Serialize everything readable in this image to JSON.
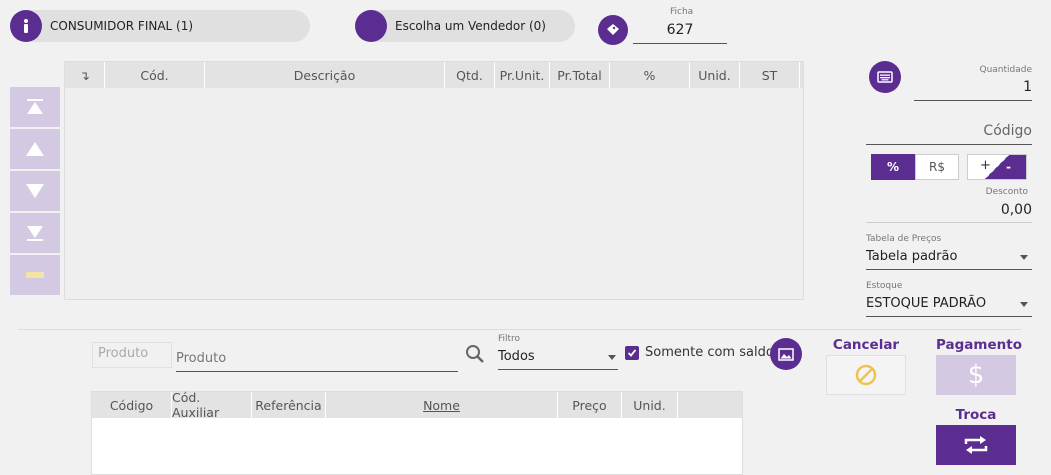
{
  "header": {
    "customer_label": "CONSUMIDOR FINAL (1)",
    "seller_label": "Escolha um Vendedor (0)",
    "ficha_label": "Ficha",
    "ficha_value": "627"
  },
  "items_table": {
    "columns": [
      "↴",
      "Cód.",
      "Descrição",
      "Qtd.",
      "Pr.Unit.",
      "Pr.Total",
      "%",
      "Unid.",
      "ST"
    ],
    "rows": []
  },
  "right_panel": {
    "quantidade_label": "Quantidade",
    "quantidade_value": "1",
    "codigo_placeholder": "Código",
    "percent_label": "%",
    "currency_label": "R$",
    "plus_label": "+",
    "minus_label": "-",
    "desconto_label": "Desconto",
    "desconto_value": "0,00",
    "tabela_label": "Tabela de Preços",
    "tabela_value": "Tabela padrão",
    "estoque_label": "Estoque",
    "estoque_value": "ESTOQUE PADRÃO"
  },
  "search": {
    "produto_small_placeholder": "Produto",
    "produto_placeholder": "Produto",
    "filtro_label": "Filtro",
    "filtro_value": "Todos",
    "somente_label": "Somente com saldo",
    "somente_checked": true
  },
  "product_table": {
    "columns": [
      "Código",
      "Cód. Auxiliar",
      "Referência",
      "Nome",
      "Preço",
      "Unid."
    ],
    "rows": []
  },
  "actions": {
    "cancelar_label": "Cancelar",
    "pagamento_label": "Pagamento",
    "troca_label": "Troca"
  },
  "colors": {
    "primary": "#5c2d91",
    "primary_light": "#d3c9e2",
    "cancel_icon": "#f0c44c"
  }
}
